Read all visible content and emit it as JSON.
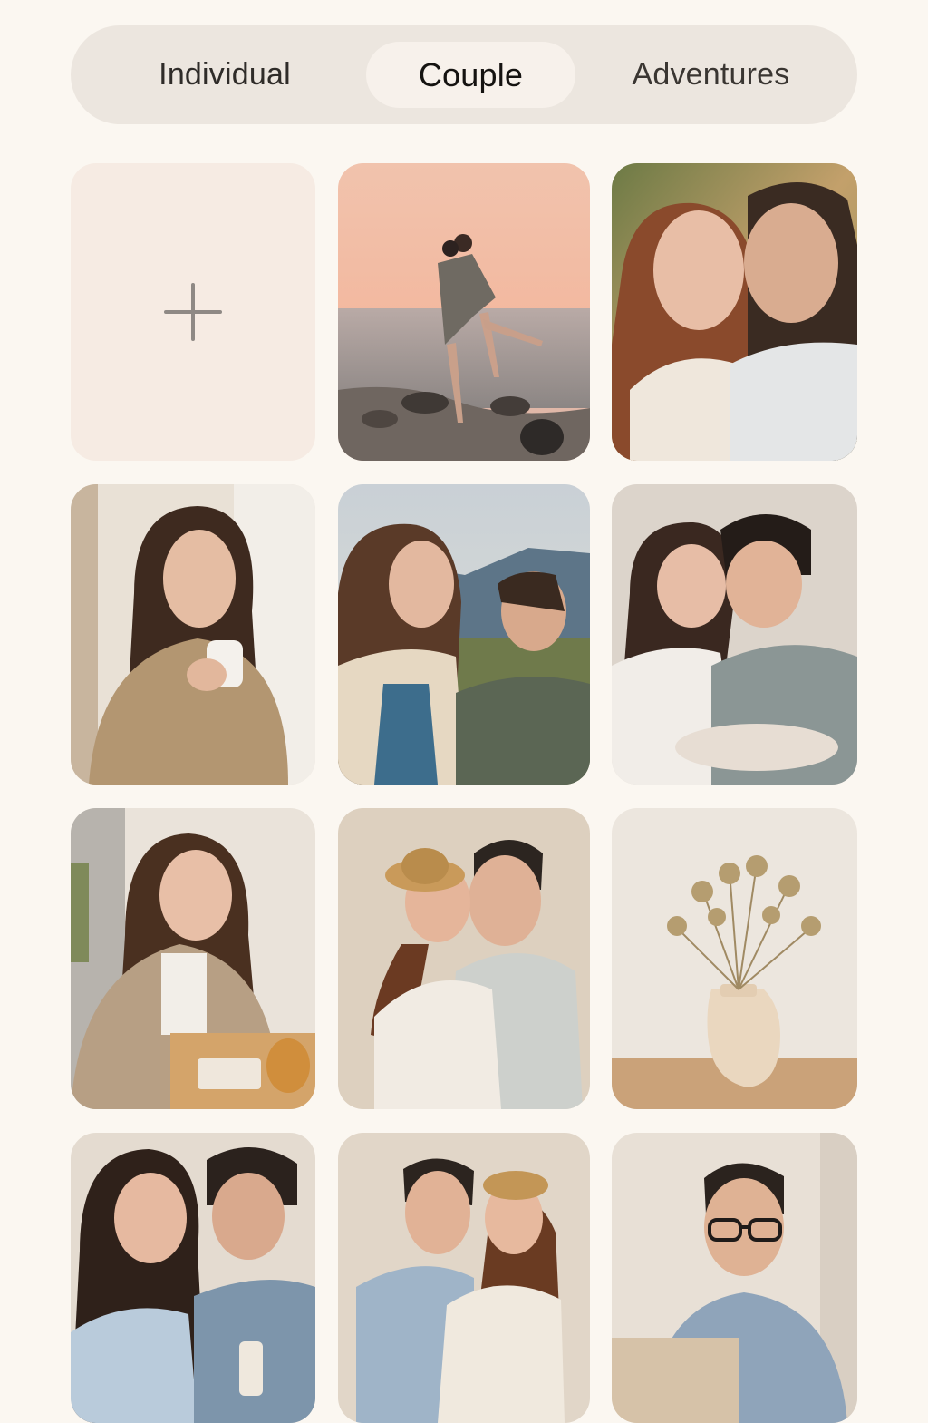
{
  "tabs": {
    "items": [
      {
        "label": "Individual",
        "selected": false
      },
      {
        "label": "Couple",
        "selected": true
      },
      {
        "label": "Adventures",
        "selected": false
      }
    ]
  },
  "gallery": {
    "add_tile_icon": "plus-icon",
    "photos": [
      "couple-kissing-on-seaside-rocks-at-sunset",
      "couple-cheek-kiss-smiling-outdoors",
      "woman-holding-coffee-mug-by-window",
      "couple-sitting-on-hillside-smiling",
      "couple-foreheads-touching-sitting-indoors",
      "woman-laughing-at-cafe-table",
      "couple-embracing-woman-in-straw-hat",
      "dried-flowers-in-ceramic-vase",
      "couple-smiling-at-each-other-at-table",
      "couple-hugging-woman-in-hat",
      "man-with-glasses-at-laptop"
    ]
  },
  "colors": {
    "background": "#fbf7f1",
    "tabbar": "#ece6df",
    "active_tab": "#f7f1eb",
    "add_tile": "#f6ebe3",
    "plus": "#8f8985"
  }
}
